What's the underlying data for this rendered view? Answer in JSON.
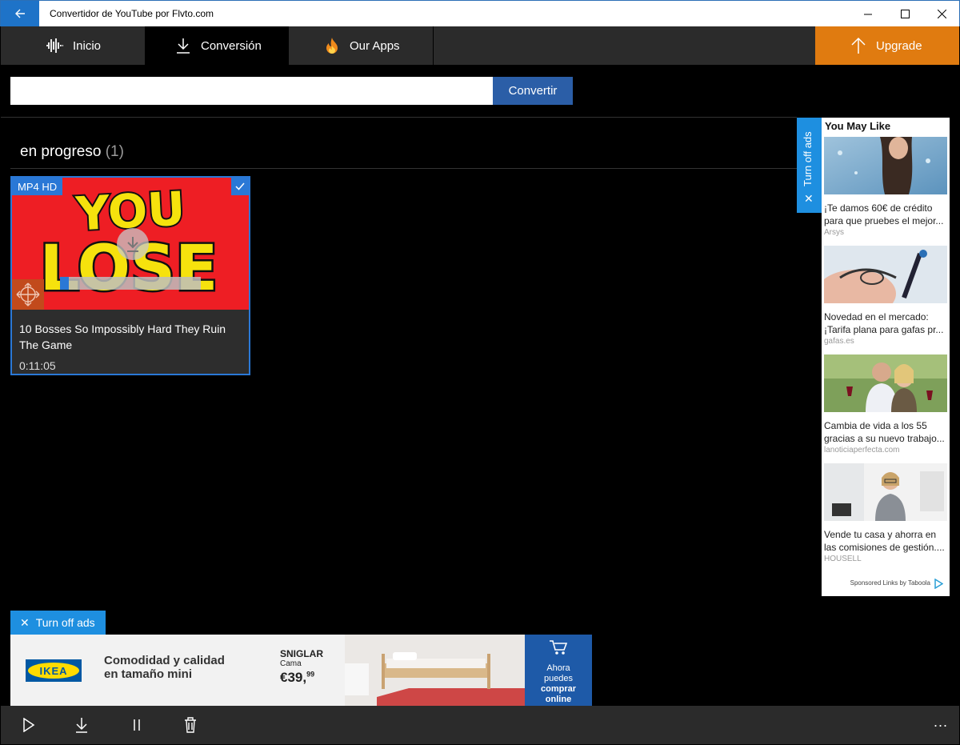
{
  "window": {
    "title": "Convertidor de YouTube por Flvto.com"
  },
  "nav": {
    "tabs": [
      {
        "label": "Inicio",
        "icon": "waveform-icon"
      },
      {
        "label": "Conversión",
        "icon": "download-icon",
        "active": true
      },
      {
        "label": "Our Apps",
        "icon": "flame-icon"
      }
    ],
    "upgrade_label": "Upgrade"
  },
  "search": {
    "value": "",
    "placeholder": "",
    "button_label": "Convertir"
  },
  "section": {
    "title": "en progreso",
    "count": "(1)"
  },
  "video": {
    "format": "MP4 HD",
    "title": "10 Bosses So Impossibly Hard They Ruin The Game",
    "duration": "0:11:05",
    "thumb_text_top": "YOU",
    "thumb_text_bottom": "LOSE",
    "progress_fraction": 0.06
  },
  "side_ad": {
    "turn_off_label": "Turn off ads",
    "title": "You May Like",
    "items": [
      {
        "text1": "¡Te damos 60€ de crédito",
        "text2": "para que pruebes el mejor...",
        "source": "Arsys"
      },
      {
        "text1": "Novedad en el mercado:",
        "text2": "¡Tarifa plana para gafas pr...",
        "source": "gafas.es"
      },
      {
        "text1": "Cambia de vida a los 55",
        "text2": "gracias a su nuevo trabajo...",
        "source": "lanoticiaperfecta.com"
      },
      {
        "text1": "Vende tu casa y ahorra en",
        "text2": "las comisiones de gestión....",
        "source": "HOUSELL"
      }
    ],
    "footer": "Sponsored Links by Taboola"
  },
  "banner": {
    "turn_off_label": "Turn off ads",
    "logo_text": "IKEA",
    "headline1": "Comodidad y calidad",
    "headline2": "en tamaño mini",
    "product_name": "SNIGLAR",
    "product_type": "Cama",
    "price": "€39,",
    "price_cents": "99",
    "cta1": "Ahora",
    "cta2": "puedes",
    "cta3": "comprar",
    "cta4": "online"
  },
  "toolbar": {
    "more_label": "..."
  },
  "colors": {
    "accent": "#2a78d6",
    "upgrade": "#e07b10",
    "convert": "#2b5ea7",
    "ads_blue": "#1e8fe0"
  }
}
